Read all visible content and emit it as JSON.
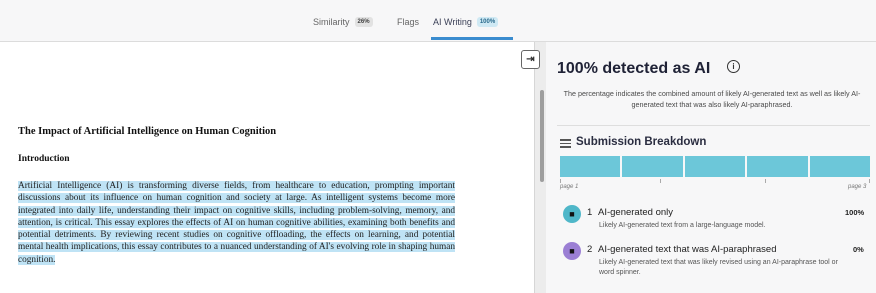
{
  "tabs": [
    {
      "label": "Similarity",
      "badge": "26%"
    },
    {
      "label": "Flags",
      "badge": ""
    },
    {
      "label": "AI Writing",
      "badge": "100%"
    }
  ],
  "document": {
    "title": "The Impact of Artificial Intelligence on Human Cognition",
    "heading": "Introduction",
    "paragraph": "Artificial Intelligence (AI) is transforming diverse fields, from healthcare to education, prompting important discussions about its influence on human cognition and society at large. As intelligent systems become more integrated into daily life, understanding their impact on cognitive skills, including problem-solving, memory, and attention, is critical. This essay explores the effects of AI on human cognitive abilities, examining both benefits and potential detriments. By reviewing recent studies on cognitive offloading, the effects on learning, and potential mental health implications, this essay contributes to a nuanced understanding of AI's evolving role in shaping human cognition."
  },
  "panel": {
    "title": "100% detected as AI",
    "description": "The percentage indicates the combined amount of likely AI-generated text as well as likely AI-generated text that was also likely AI-paraphrased.",
    "breakdown_title": "Submission Breakdown",
    "page_start": "page 1",
    "page_end": "page 3",
    "accent_color": "#6cc7d9",
    "categories": [
      {
        "number": "1",
        "label": "AI-generated only",
        "percent": "100%",
        "description": "Likely AI-generated text from a large-language model.",
        "icon": "robot-icon",
        "color": "#4fb7c9"
      },
      {
        "number": "2",
        "label": "AI-generated text that was AI-paraphrased",
        "percent": "0%",
        "description": "Likely AI-generated text that was likely revised using an AI-paraphrase tool or word spinner.",
        "icon": "paraphrase-robot-icon",
        "color": "#9b7fd4"
      }
    ]
  }
}
